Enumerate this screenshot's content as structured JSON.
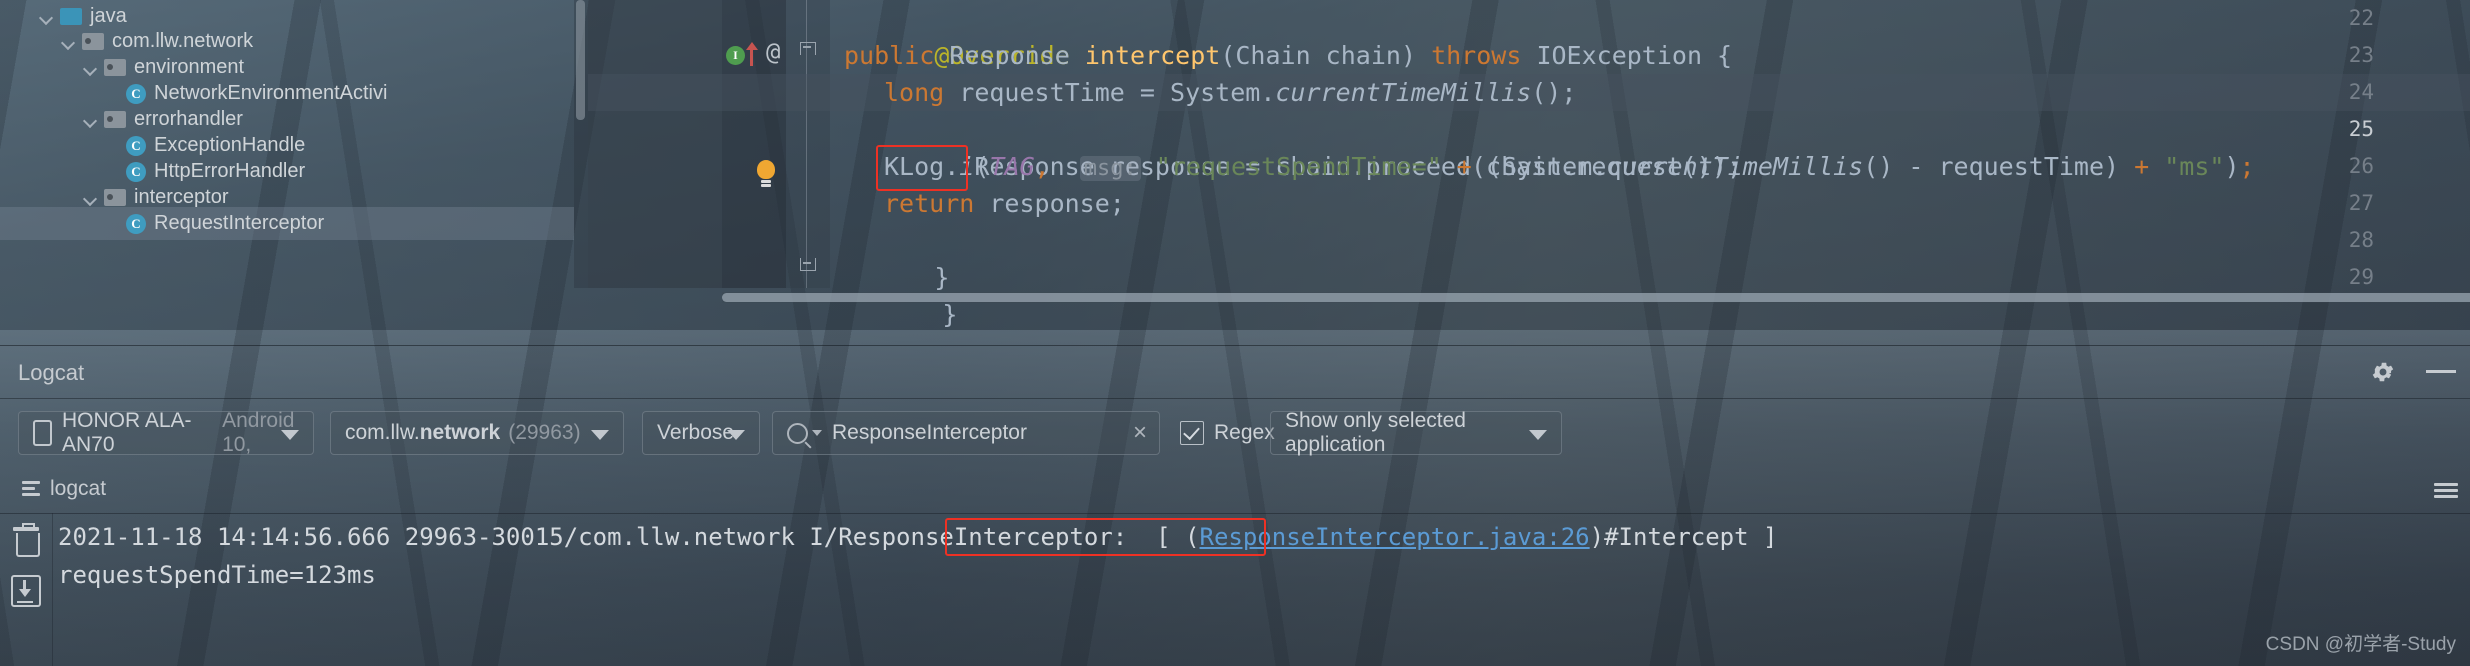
{
  "project_tree": {
    "items": [
      {
        "label": "java",
        "icon": "source-folder-icon",
        "indent": 0,
        "type": "folder-src",
        "expanded": true
      },
      {
        "label": "com.llw.network",
        "icon": "package-icon",
        "indent": 1,
        "type": "folder",
        "expanded": true
      },
      {
        "label": "environment",
        "icon": "package-icon",
        "indent": 2,
        "type": "folder",
        "expanded": true
      },
      {
        "label": "NetworkEnvironmentActivi",
        "icon": "java-class-icon",
        "indent": 3,
        "type": "class",
        "expanded": false
      },
      {
        "label": "errorhandler",
        "icon": "package-icon",
        "indent": 2,
        "type": "folder",
        "expanded": true
      },
      {
        "label": "ExceptionHandle",
        "icon": "java-class-icon",
        "indent": 3,
        "type": "class",
        "expanded": false
      },
      {
        "label": "HttpErrorHandler",
        "icon": "java-class-icon",
        "indent": 3,
        "type": "class",
        "expanded": false
      },
      {
        "label": "interceptor",
        "icon": "package-icon",
        "indent": 2,
        "type": "folder",
        "expanded": true
      },
      {
        "label": "RequestInterceptor",
        "icon": "java-class-icon",
        "indent": 3,
        "type": "class",
        "selected": true
      }
    ],
    "class_icon_letter": "C"
  },
  "editor": {
    "line_numbers": [
      "22",
      "23",
      "24",
      "25",
      "26",
      "27",
      "28",
      "29"
    ],
    "current_line": "25",
    "gutter_icons": {
      "implements_letter": "I",
      "annotation_symbol": "@"
    },
    "lines": [
      {
        "num": "22",
        "text": "@Override"
      },
      {
        "num": "23",
        "text": "public Response intercept(Chain chain) throws IOException {"
      },
      {
        "num": "24",
        "text": "long requestTime = System.currentTimeMillis();"
      },
      {
        "num": "25",
        "text": "Response response = chain.proceed(chain.request());"
      },
      {
        "num": "26",
        "text": "KLog.i(TAG, msg: \"requestSpendTime=\" + (System.currentTimeMillis() - requestTime) + \"ms\");"
      },
      {
        "num": "27",
        "text": "return response;"
      },
      {
        "num": "28",
        "text": "}"
      },
      {
        "num": "29",
        "text": "}"
      }
    ],
    "tokens": {
      "annotation": "@Override",
      "kw_public": "public",
      "type_response": "Response",
      "method_intercept": "intercept",
      "param_chain": "(Chain chain)",
      "kw_throws": "throws",
      "type_ioexception": "IOException {",
      "kw_long": "long",
      "var_requesttime": "requestTime =",
      "sys_current": "System.",
      "mth_currenttimemillis": "currentTimeMillis",
      "call_end": "();",
      "resp_decl": "Response response = chain.proceed(chain.request());",
      "klog": "KLog.",
      "klog_i": "i",
      "tag": "TAG",
      "hint_msg": "msg:",
      "str_spend": "\"requestSpendTime=\"",
      "str_ms": "\"ms\"",
      "minus_requesttime": "- requestTime)",
      "kw_return": "return",
      "var_response": "response;",
      "brace_close": "}"
    },
    "highlight_box_target": "KLog.i"
  },
  "logcat": {
    "title": "Logcat",
    "toolbar": {
      "device": "HONOR ALA-AN70",
      "device_suffix": "Android 10,",
      "process_prefix": "com.llw.",
      "process_bold": "network",
      "process_pid": "(29963)",
      "level": "Verbose",
      "search_value": "ResponseInterceptor",
      "search_clear": "×",
      "regex_label": "Regex",
      "regex_checked": true,
      "filter": "Show only selected application"
    },
    "tab_label": "logcat",
    "log_entries": [
      {
        "prefix": "2021-11-18 14:14:56.666 29963-30015/com.llw.network I/ResponseInterceptor:  [ (",
        "link": "ResponseInterceptor.java:26",
        "suffix": ")#Intercept ]",
        "continuation": "requestSpendTime=123ms"
      }
    ]
  },
  "watermark": "CSDN @初学者-Study",
  "colors": {
    "accent_red": "#ee3124",
    "link_blue": "#5b9bd5",
    "keyword_orange": "#cc7832",
    "method_yellow": "#ffc66d",
    "string_green": "#6a8759",
    "annotation_olive": "#bbb529",
    "field_purple": "#9876aa",
    "class_icon_blue": "#3f9cc0",
    "source_folder_blue": "#3b94b8",
    "bulb_orange": "#f0a732",
    "implements_green": "#4f9d4f"
  }
}
